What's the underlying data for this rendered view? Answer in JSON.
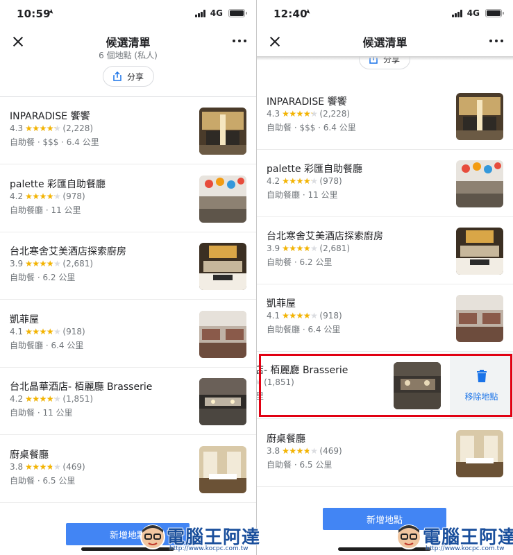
{
  "left": {
    "status": {
      "time": "10:59",
      "network": "4G"
    },
    "header": {
      "title": "候選清單",
      "subtitle": "6 個地點 (私人)",
      "share_label": "分享"
    },
    "items": [
      {
        "name": "INPARADISE 饗饗",
        "rating": "4.3",
        "rating_value": 4.3,
        "reviews": "(2,228)",
        "meta": "自助餐 · $$$ · 6.4 公里",
        "thumb": "restaurant-photo"
      },
      {
        "name": "palette 彩匯自助餐廳",
        "rating": "4.2",
        "rating_value": 4.2,
        "reviews": "(978)",
        "meta": "自助餐廳 · 11 公里",
        "thumb": "restaurant-photo"
      },
      {
        "name": "台北寒舍艾美酒店探索廚房",
        "rating": "3.9",
        "rating_value": 3.9,
        "reviews": "(2,681)",
        "meta": "自助餐 · 6.2 公里",
        "thumb": "restaurant-photo"
      },
      {
        "name": "凱菲屋",
        "rating": "4.1",
        "rating_value": 4.1,
        "reviews": "(918)",
        "meta": "自助餐廳 · 6.4 公里",
        "thumb": "restaurant-photo"
      },
      {
        "name": "台北晶華酒店- 栢麗廳 Brasserie",
        "rating": "4.2",
        "rating_value": 4.2,
        "reviews": "(1,851)",
        "meta": "自助餐 · 11 公里",
        "thumb": "restaurant-photo"
      },
      {
        "name": "廚桌餐廳",
        "rating": "3.8",
        "rating_value": 3.8,
        "reviews": "(469)",
        "meta": "自助餐 · 6.5 公里",
        "thumb": "restaurant-photo"
      }
    ],
    "add_button_label": "新增地點"
  },
  "right": {
    "status": {
      "time": "12:40",
      "network": "4G"
    },
    "header": {
      "title": "候選清單",
      "share_label": "分享"
    },
    "items": [
      {
        "name": "INPARADISE 饗饗",
        "rating": "4.3",
        "rating_value": 4.3,
        "reviews": "(2,228)",
        "meta": "自助餐 · $$$ · 6.4 公里"
      },
      {
        "name": "palette 彩匯自助餐廳",
        "rating": "4.2",
        "rating_value": 4.2,
        "reviews": "(978)",
        "meta": "自助餐廳 · 11 公里"
      },
      {
        "name": "台北寒舍艾美酒店探索廚房",
        "rating": "3.9",
        "rating_value": 3.9,
        "reviews": "(2,681)",
        "meta": "自助餐 · 6.2 公里"
      },
      {
        "name": "凱菲屋",
        "rating": "4.1",
        "rating_value": 4.1,
        "reviews": "(918)",
        "meta": "自助餐廳 · 6.4 公里"
      }
    ],
    "swiped_item": {
      "name": "店- 栢麗廳 Brasserie",
      "rating": "(1,851)",
      "meta": "里"
    },
    "remove_label": "移除地點",
    "last_item": {
      "name": "廚桌餐廳",
      "rating": "3.8",
      "rating_value": 3.8,
      "reviews": "(469)",
      "meta": "自助餐 · 6.5 公里"
    },
    "add_button_label": "新增地點"
  },
  "watermark": {
    "text": "電腦王阿達",
    "url": "http://www.kocpc.com.tw"
  },
  "colors": {
    "star": "#f4b400",
    "accent": "#4285f4",
    "highlight": "#e10012",
    "remove": "#1a73e8"
  },
  "icons": {
    "close": "close-icon",
    "more": "more-icon",
    "share": "share-icon",
    "trash": "trash-icon"
  }
}
